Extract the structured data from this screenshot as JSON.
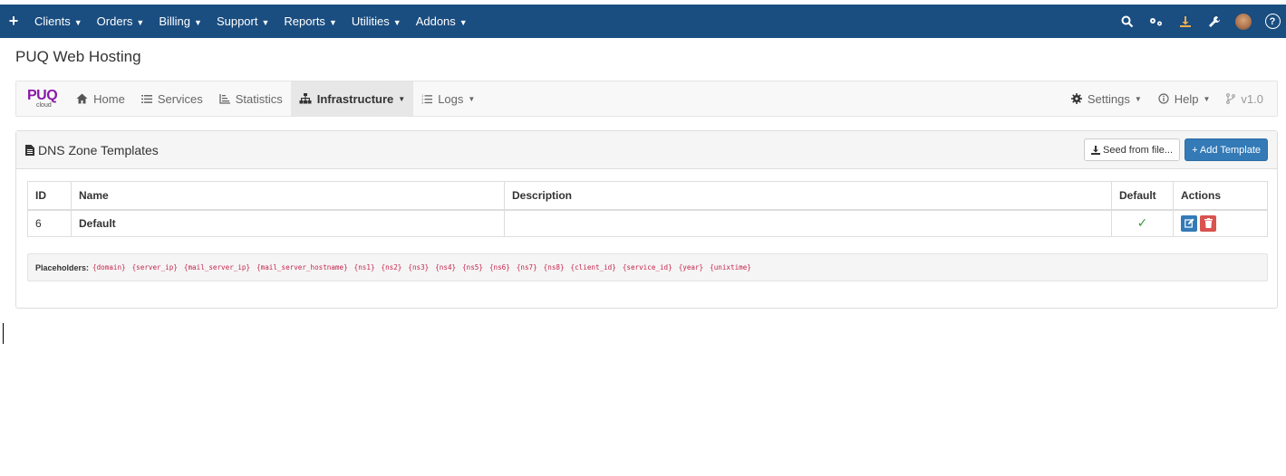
{
  "topbar": {
    "add_label": "+",
    "menu": [
      "Clients",
      "Orders",
      "Billing",
      "Support",
      "Reports",
      "Utilities",
      "Addons"
    ],
    "right_icons": [
      "search-icon",
      "cogs-icon",
      "download-icon",
      "wrench-icon",
      "avatar",
      "help-icon"
    ],
    "help_glyph": "?"
  },
  "page_title": "PUQ Web Hosting",
  "module_nav": {
    "brand_main": "PUQ",
    "brand_sub": "cloud",
    "items": [
      {
        "label": "Home",
        "icon": "home-icon"
      },
      {
        "label": "Services",
        "icon": "list-icon"
      },
      {
        "label": "Statistics",
        "icon": "chart-icon"
      },
      {
        "label": "Infrastructure",
        "icon": "sitemap-icon",
        "active": true,
        "dropdown": true
      },
      {
        "label": "Logs",
        "icon": "list-ol-icon",
        "dropdown": true
      }
    ],
    "right": {
      "settings": "Settings",
      "help": "Help",
      "version": "v1.0"
    }
  },
  "panel": {
    "title": "DNS Zone Templates",
    "seed_button": "Seed from file...",
    "add_button": "+ Add Template"
  },
  "table": {
    "headers": [
      "ID",
      "Name",
      "Description",
      "Default",
      "Actions"
    ],
    "rows": [
      {
        "id": "6",
        "name": "Default",
        "description": "",
        "default": true
      }
    ]
  },
  "placeholders": {
    "label": "Placeholders:",
    "items": [
      "{domain}",
      "{server_ip}",
      "{mail_server_ip}",
      "{mail_server_hostname}",
      "{ns1}",
      "{ns2}",
      "{ns3}",
      "{ns4}",
      "{ns5}",
      "{ns6}",
      "{ns7}",
      "{ns8}",
      "{client_id}",
      "{service_id}",
      "{year}",
      "{unixtime}"
    ]
  },
  "colors": {
    "topbar": "#1a4d80",
    "primary": "#337ab7",
    "danger": "#d9534f",
    "success": "#3c9a3c",
    "code": "#c7254e",
    "brand": "#8a1aa8"
  }
}
